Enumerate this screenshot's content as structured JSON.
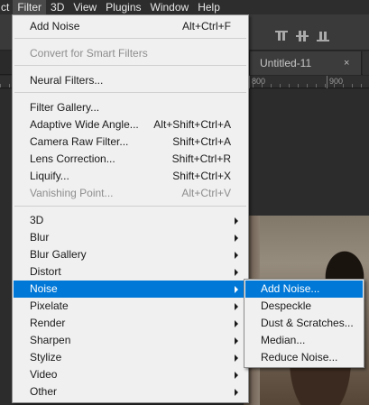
{
  "menubar": {
    "items": [
      "ct",
      "Filter",
      "3D",
      "View",
      "Plugins",
      "Window",
      "Help"
    ],
    "active": "Filter"
  },
  "document_tab": {
    "title": "Untitled-11",
    "close_label": "×"
  },
  "ruler": {
    "labels": [
      "800",
      "900"
    ]
  },
  "filter_menu": {
    "last_filter": {
      "label": "Add Noise",
      "shortcut": "Alt+Ctrl+F"
    },
    "convert_smart": {
      "label": "Convert for Smart Filters",
      "disabled": true
    },
    "neural_filters": {
      "label": "Neural Filters..."
    },
    "filter_gallery": {
      "label": "Filter Gallery..."
    },
    "adaptive_wide_angle": {
      "label": "Adaptive Wide Angle...",
      "shortcut": "Alt+Shift+Ctrl+A"
    },
    "camera_raw": {
      "label": "Camera Raw Filter...",
      "shortcut": "Shift+Ctrl+A"
    },
    "lens_correction": {
      "label": "Lens Correction...",
      "shortcut": "Shift+Ctrl+R"
    },
    "liquify": {
      "label": "Liquify...",
      "shortcut": "Shift+Ctrl+X"
    },
    "vanishing_point": {
      "label": "Vanishing Point...",
      "shortcut": "Alt+Ctrl+V",
      "disabled": true
    },
    "submenus": [
      "3D",
      "Blur",
      "Blur Gallery",
      "Distort",
      "Noise",
      "Pixelate",
      "Render",
      "Sharpen",
      "Stylize",
      "Video",
      "Other"
    ],
    "highlighted_submenu": "Noise"
  },
  "noise_submenu": {
    "items": [
      "Add Noise...",
      "Despeckle",
      "Dust & Scratches...",
      "Median...",
      "Reduce Noise..."
    ],
    "highlighted": "Add Noise..."
  },
  "colors": {
    "highlight": "#0078d7",
    "menu_bg": "#f0f0f0",
    "menubar_bg": "#2d2d2d",
    "disabled_text": "#8d8d8d"
  }
}
